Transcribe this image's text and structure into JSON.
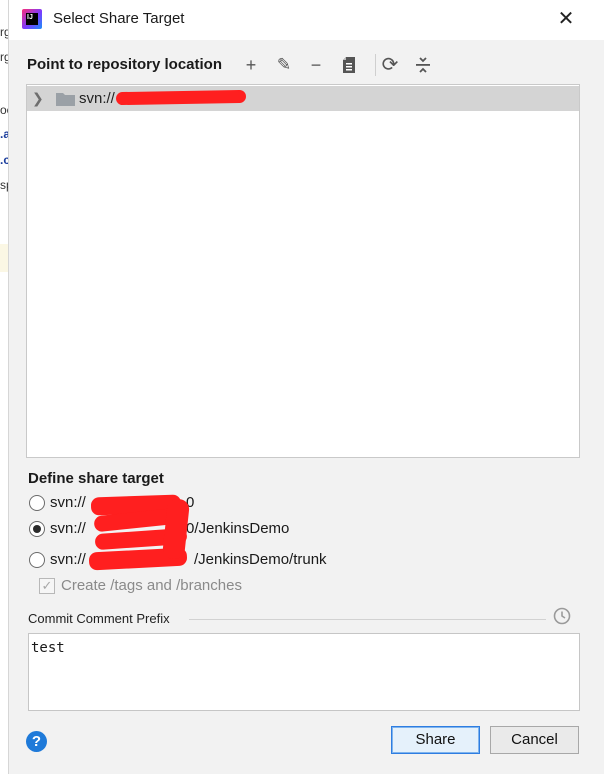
{
  "background": {
    "fragments": [
      "rg",
      "rg",
      "oc",
      ".a",
      ".c",
      "sp"
    ]
  },
  "window": {
    "title": "Select Share Target",
    "close_label": "✕",
    "app_icon_text": "IJ"
  },
  "toolbar": {
    "label": "Point to repository location",
    "buttons": [
      {
        "icon": "plus-icon",
        "glyph": "+"
      },
      {
        "icon": "edit-icon",
        "glyph": "✎"
      },
      {
        "icon": "minus-icon",
        "glyph": "−"
      },
      {
        "icon": "browse-icon",
        "glyph": ""
      },
      {
        "icon": "refresh-icon",
        "glyph": "⟳"
      },
      {
        "icon": "collapse-all-icon",
        "glyph": ""
      }
    ]
  },
  "tree": {
    "items": [
      {
        "label": "svn://",
        "expanded": false,
        "selected": true
      }
    ]
  },
  "share_target": {
    "title": "Define share target",
    "options": [
      {
        "label": "svn://",
        "suffix": "0",
        "checked": false
      },
      {
        "label": "svn://",
        "suffix": "0/JenkinsDemo",
        "checked": true
      },
      {
        "label": "svn://",
        "suffix": "/JenkinsDemo/trunk",
        "checked": false
      }
    ],
    "create_tags": {
      "label": "Create /tags and /branches",
      "checked": true,
      "disabled": true
    }
  },
  "commit": {
    "prefix_label": "Commit Comment Prefix",
    "value": "test"
  },
  "buttons": {
    "help": "?",
    "share": "Share",
    "cancel": "Cancel"
  },
  "colors": {
    "accent": "#2e7de1",
    "redaction": "#ff1f1f",
    "selection": "#d4d4d4"
  }
}
